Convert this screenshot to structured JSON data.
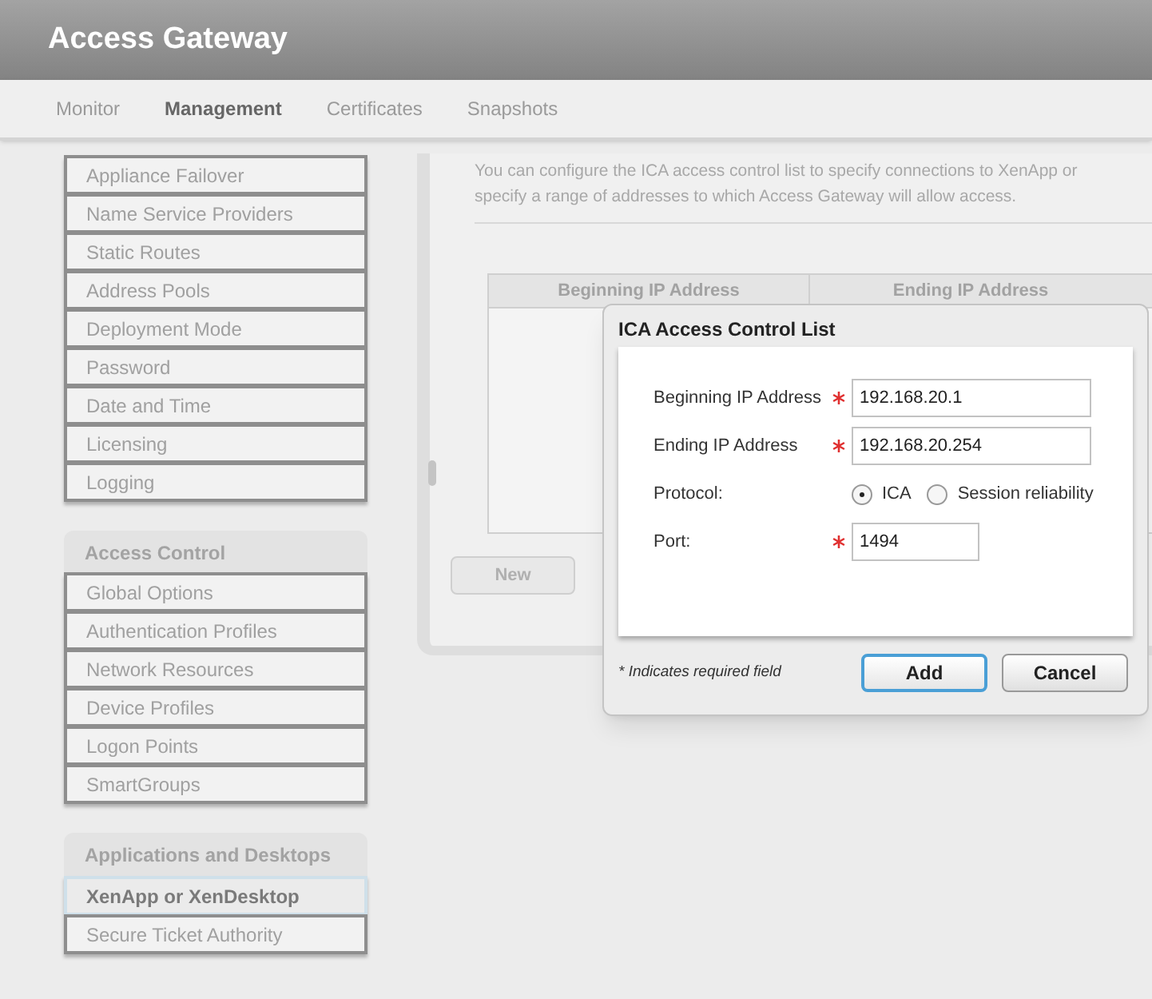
{
  "header": {
    "title": "Access Gateway"
  },
  "nav": [
    {
      "label": "Monitor",
      "selected": false
    },
    {
      "label": "Management",
      "selected": true
    },
    {
      "label": "Certificates",
      "selected": false
    },
    {
      "label": "Snapshots",
      "selected": false
    }
  ],
  "sidebar": {
    "groups": [
      {
        "items": [
          {
            "label": "Appliance Failover",
            "selected": false
          },
          {
            "label": "Name Service Providers",
            "selected": false
          },
          {
            "label": "Static Routes",
            "selected": false
          },
          {
            "label": "Address Pools",
            "selected": false
          },
          {
            "label": "Deployment Mode",
            "selected": false
          },
          {
            "label": "Password",
            "selected": false
          },
          {
            "label": "Date and Time",
            "selected": false
          },
          {
            "label": "Licensing",
            "selected": false
          },
          {
            "label": "Logging",
            "selected": false
          }
        ]
      },
      {
        "heading": "Access Control",
        "items": [
          {
            "label": "Global Options",
            "selected": false
          },
          {
            "label": "Authentication Profiles",
            "selected": false
          },
          {
            "label": "Network Resources",
            "selected": false
          },
          {
            "label": "Device Profiles",
            "selected": false
          },
          {
            "label": "Logon Points",
            "selected": false
          },
          {
            "label": "SmartGroups",
            "selected": false
          }
        ]
      },
      {
        "heading": "Applications and Desktops",
        "items": [
          {
            "label": "XenApp or XenDesktop",
            "selected": true
          },
          {
            "label": "Secure Ticket Authority",
            "selected": false
          }
        ]
      }
    ]
  },
  "main": {
    "description": [
      "You can configure the ICA access control list to specify connections to XenApp or",
      "specify a range of addresses to which Access Gateway will allow access."
    ],
    "table": {
      "columns": [
        "Beginning IP Address",
        "Ending IP Address"
      ]
    },
    "buttons": [
      "New"
    ]
  },
  "dialog": {
    "title": "ICA Access Control List",
    "fields": [
      {
        "kind": "text",
        "label": "Beginning IP Address",
        "required": true,
        "value": "192.168.20.1"
      },
      {
        "kind": "text",
        "label": "Ending IP Address",
        "required": true,
        "value": "192.168.20.254"
      },
      {
        "kind": "radio",
        "label": "Protocol:",
        "options": [
          {
            "label": "ICA",
            "selected": true
          },
          {
            "label": "Session reliability",
            "selected": false
          }
        ]
      },
      {
        "kind": "text",
        "label": "Port:",
        "required": true,
        "value": "1494"
      }
    ],
    "note": "* Indicates required field",
    "buttons": [
      {
        "label": "Add",
        "default": true
      },
      {
        "label": "Cancel",
        "default": false
      }
    ]
  }
}
